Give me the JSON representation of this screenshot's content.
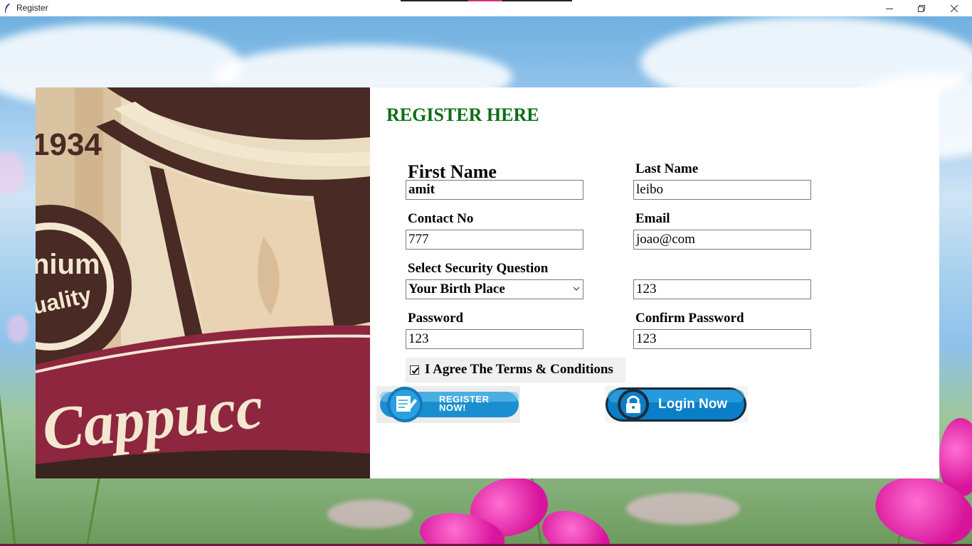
{
  "window": {
    "title": "Register",
    "icon": "feather-icon",
    "controls": [
      "minimize-icon",
      "restore-icon",
      "close-icon"
    ]
  },
  "form": {
    "heading": "REGISTER HERE",
    "first_name": {
      "label": "First Name",
      "value": "amit"
    },
    "last_name": {
      "label": "Last Name",
      "value": "leibo"
    },
    "contact": {
      "label": "Contact No",
      "value": "777"
    },
    "email": {
      "label": "Email",
      "value": "joao@com"
    },
    "security_question": {
      "label": "Select Security Question",
      "selected": "Your Birth Place"
    },
    "security_answer": {
      "value": "123"
    },
    "password": {
      "label": "Password",
      "value": "123"
    },
    "confirm_password": {
      "label": "Confirm Password",
      "value": "123"
    },
    "agree": {
      "label": "I Agree The Terms & Conditions",
      "checked": true
    }
  },
  "buttons": {
    "register_line1": "REGISTER",
    "register_line2": "NOW!",
    "login": "Login Now"
  },
  "poster": {
    "year": "1934",
    "badge_line1": "nium",
    "badge_line2": "uality",
    "script_text": "Cappucc"
  },
  "colors": {
    "heading": "#0a6e14",
    "poster_dark": "#4a2a24",
    "poster_red": "#8e2640",
    "poster_cream": "#f3e7d0",
    "button_blue": "#1a8fd0"
  }
}
